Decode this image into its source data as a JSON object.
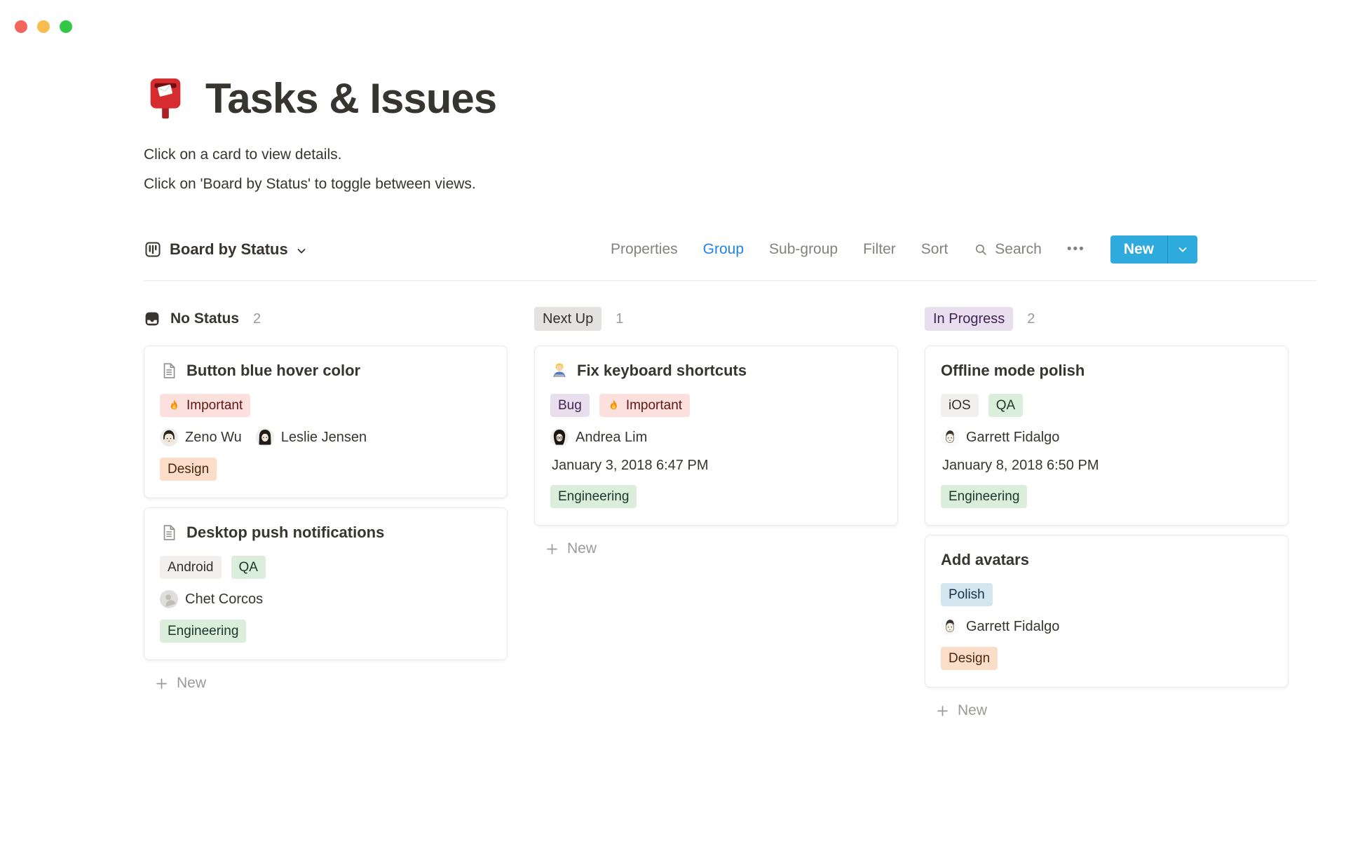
{
  "window": {
    "controls": [
      {
        "name": "close-button"
      },
      {
        "name": "minimize-button"
      },
      {
        "name": "zoom-button"
      }
    ]
  },
  "page": {
    "icon": "postbox-emoji",
    "title": "Tasks & Issues",
    "description_lines": [
      "Click on a card to view details.",
      "Click on 'Board by Status' to toggle between views."
    ]
  },
  "toolbar": {
    "view_switcher": {
      "icon": "board-icon",
      "label": "Board by Status",
      "chevron": "chevron-down-icon"
    },
    "menu_items": [
      {
        "label": "Properties",
        "active": false
      },
      {
        "label": "Group",
        "active": true
      },
      {
        "label": "Sub-group",
        "active": false
      },
      {
        "label": "Filter",
        "active": false
      },
      {
        "label": "Sort",
        "active": false
      }
    ],
    "search": {
      "icon": "search-icon",
      "label": "Search"
    },
    "more_label": "•••",
    "new_button": {
      "label": "New",
      "chevron": "chevron-down-icon"
    }
  },
  "board": {
    "columns": [
      {
        "id": "no-status",
        "header": {
          "type": "plain",
          "icon": "inbox-icon",
          "label": "No Status",
          "count": 2
        },
        "cards": [
          {
            "icon": "document-icon",
            "title": "Button blue hover color",
            "rows": [
              {
                "type": "tags",
                "tags": [
                  {
                    "label": "Important",
                    "color": "red",
                    "icon": "fire-icon"
                  }
                ]
              },
              {
                "type": "people",
                "people": [
                  {
                    "name": "Zeno Wu",
                    "avatar": "avatar-zeno"
                  },
                  {
                    "name": "Leslie Jensen",
                    "avatar": "avatar-leslie"
                  }
                ]
              },
              {
                "type": "tags",
                "tags": [
                  {
                    "label": "Design",
                    "color": "orange"
                  }
                ]
              }
            ]
          },
          {
            "icon": "document-icon",
            "title": "Desktop push notifications",
            "rows": [
              {
                "type": "tags",
                "tags": [
                  {
                    "label": "Android",
                    "color": "lightgray"
                  },
                  {
                    "label": "QA",
                    "color": "green"
                  }
                ]
              },
              {
                "type": "people",
                "people": [
                  {
                    "name": "Chet Corcos",
                    "avatar": "avatar-placeholder"
                  }
                ]
              },
              {
                "type": "tags",
                "tags": [
                  {
                    "label": "Engineering",
                    "color": "green"
                  }
                ]
              }
            ]
          }
        ],
        "new_label": "New"
      },
      {
        "id": "next-up",
        "header": {
          "type": "badge",
          "color": "gray",
          "label": "Next Up",
          "count": 1
        },
        "cards": [
          {
            "icon": "technologist-emoji",
            "title": "Fix keyboard shortcuts",
            "rows": [
              {
                "type": "tags",
                "tags": [
                  {
                    "label": "Bug",
                    "color": "purple"
                  },
                  {
                    "label": "Important",
                    "color": "red",
                    "icon": "fire-icon"
                  }
                ]
              },
              {
                "type": "people",
                "people": [
                  {
                    "name": "Andrea Lim",
                    "avatar": "avatar-andrea"
                  }
                ]
              },
              {
                "type": "date",
                "value": "January 3, 2018 6:47 PM"
              },
              {
                "type": "tags",
                "tags": [
                  {
                    "label": "Engineering",
                    "color": "green"
                  }
                ]
              }
            ]
          }
        ],
        "new_label": "New"
      },
      {
        "id": "in-progress",
        "header": {
          "type": "badge",
          "color": "purple",
          "label": "In Progress",
          "count": 2
        },
        "cards": [
          {
            "icon": null,
            "title": "Offline mode polish",
            "rows": [
              {
                "type": "tags",
                "tags": [
                  {
                    "label": "iOS",
                    "color": "lightgray"
                  },
                  {
                    "label": "QA",
                    "color": "green"
                  }
                ]
              },
              {
                "type": "people",
                "people": [
                  {
                    "name": "Garrett Fidalgo",
                    "avatar": "avatar-garrett"
                  }
                ]
              },
              {
                "type": "date",
                "value": "January 8, 2018 6:50 PM"
              },
              {
                "type": "tags",
                "tags": [
                  {
                    "label": "Engineering",
                    "color": "green"
                  }
                ]
              }
            ]
          },
          {
            "icon": null,
            "title": "Add avatars",
            "rows": [
              {
                "type": "tags",
                "tags": [
                  {
                    "label": "Polish",
                    "color": "blue"
                  }
                ]
              },
              {
                "type": "people",
                "people": [
                  {
                    "name": "Garrett Fidalgo",
                    "avatar": "avatar-garrett"
                  }
                ]
              },
              {
                "type": "tags",
                "tags": [
                  {
                    "label": "Design",
                    "color": "orange"
                  }
                ]
              }
            ]
          }
        ],
        "new_label": "New"
      }
    ]
  },
  "colors": {
    "accent": "#2EAADC",
    "active_link": "#2383E2",
    "text": "#37352F",
    "muted": "#9B9A97",
    "traffic_lights": [
      "#F4645C",
      "#F9BD4F",
      "#33C748"
    ],
    "badges": {
      "red": {
        "bg": "#FBE0DD",
        "text": "#5D1715"
      },
      "orange": {
        "bg": "#FADEC9",
        "text": "#49290E"
      },
      "green": {
        "bg": "#DBEDDB",
        "text": "#1C3829"
      },
      "lightgray": {
        "bg": "#F1F0EE",
        "text": "#32302C"
      },
      "gray": {
        "bg": "#E3E2E0",
        "text": "#32302C"
      },
      "purple": {
        "bg": "#E8DEEE",
        "text": "#412454"
      },
      "blue": {
        "bg": "#D3E5EF",
        "text": "#183347"
      }
    }
  }
}
